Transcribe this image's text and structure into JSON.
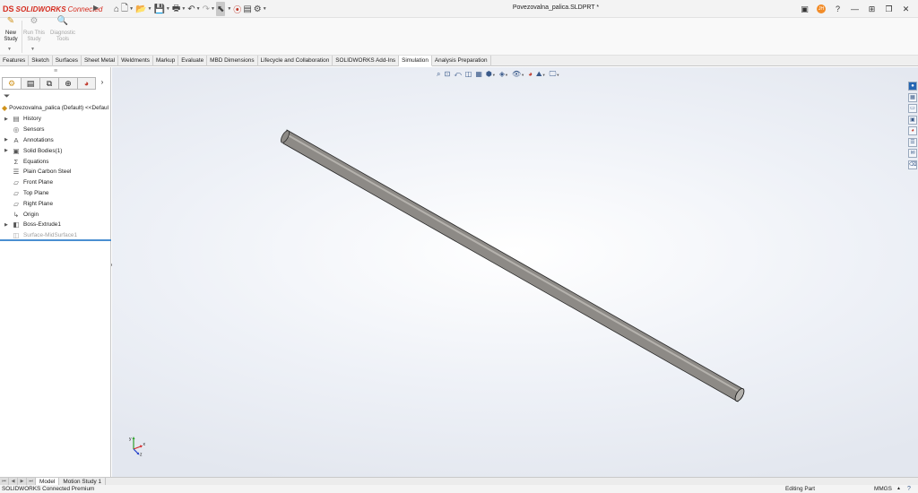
{
  "app": {
    "brand_prefix": "DS",
    "brand_name": "SOLIDWORKS",
    "brand_suffix": "Connected",
    "document_title": "Povezovalna_palica.SLDPRT *",
    "user_initials": "JH"
  },
  "quick_access": {
    "home_icon": "⌂",
    "new_icon": "🗋",
    "open_icon": "📂",
    "save_icon": "💾",
    "print_icon": "🖶",
    "undo_icon": "↶",
    "redo_icon": "↷",
    "select_icon": "⬉",
    "traffic_icon": "⬛",
    "options_icon": "▤",
    "gear_icon": "⚙"
  },
  "window_controls": {
    "command_icon": "▣",
    "help_icon": "?",
    "minimize_icon": "—",
    "tile_icon": "⊞",
    "restore_icon": "❐",
    "close_icon": "✕"
  },
  "command_manager": {
    "buttons": [
      {
        "label_1": "New",
        "label_2": "Study",
        "icon": "✎",
        "enabled": true
      },
      {
        "label_1": "Run This",
        "label_2": "Study",
        "icon": "⚙",
        "enabled": false
      },
      {
        "label_1": "Diagnostic",
        "label_2": "Tools",
        "icon": "🔍",
        "enabled": false
      }
    ]
  },
  "tabs": [
    {
      "label": "Features",
      "active": false
    },
    {
      "label": "Sketch",
      "active": false
    },
    {
      "label": "Surfaces",
      "active": false
    },
    {
      "label": "Sheet Metal",
      "active": false
    },
    {
      "label": "Weldments",
      "active": false
    },
    {
      "label": "Markup",
      "active": false
    },
    {
      "label": "Evaluate",
      "active": false
    },
    {
      "label": "MBD Dimensions",
      "active": false
    },
    {
      "label": "Lifecycle and Collaboration",
      "active": false
    },
    {
      "label": "SOLIDWORKS Add-Ins",
      "active": false
    },
    {
      "label": "Simulation",
      "active": true
    },
    {
      "label": "Analysis Preparation",
      "active": false
    }
  ],
  "feature_manager": {
    "panel_tabs": [
      "feature-tree",
      "property-manager",
      "configuration-manager",
      "dimxpert-manager",
      "display-manager"
    ],
    "root_label": "Povezovalna_palica (Default) <<Defaul",
    "tree": [
      {
        "label": "History",
        "icon": "▤",
        "expandable": true,
        "dim": false
      },
      {
        "label": "Sensors",
        "icon": "◎",
        "expandable": false,
        "dim": false
      },
      {
        "label": "Annotations",
        "icon": "A",
        "expandable": true,
        "dim": false
      },
      {
        "label": "Solid Bodies(1)",
        "icon": "▣",
        "expandable": true,
        "dim": false
      },
      {
        "label": "Equations",
        "icon": "Σ",
        "expandable": false,
        "dim": false
      },
      {
        "label": "Plain Carbon Steel",
        "icon": "☰",
        "expandable": false,
        "dim": false
      },
      {
        "label": "Front Plane",
        "icon": "▱",
        "expandable": false,
        "dim": false
      },
      {
        "label": "Top Plane",
        "icon": "▱",
        "expandable": false,
        "dim": false
      },
      {
        "label": "Right Plane",
        "icon": "▱",
        "expandable": false,
        "dim": false
      },
      {
        "label": "Origin",
        "icon": "↳",
        "expandable": false,
        "dim": false
      },
      {
        "label": "Boss-Extrude1",
        "icon": "◧",
        "expandable": true,
        "dim": false
      },
      {
        "label": "Surface-MidSurface1",
        "icon": "◫",
        "expandable": false,
        "dim": true
      }
    ]
  },
  "viewport": {
    "colors": {
      "part": "#8d8a86",
      "part_edge": "#2a2a2a",
      "part_end": "#b2b0ac"
    },
    "triad": {
      "x_label": "x",
      "y_label": "y",
      "z_label": "z"
    }
  },
  "bottom_tabs": [
    {
      "label": "Model",
      "active": true
    },
    {
      "label": "Motion Study 1",
      "active": false
    }
  ],
  "status": {
    "product": "SOLIDWORKS Connected Premium",
    "mode": "Editing Part",
    "units": "MMGS"
  }
}
